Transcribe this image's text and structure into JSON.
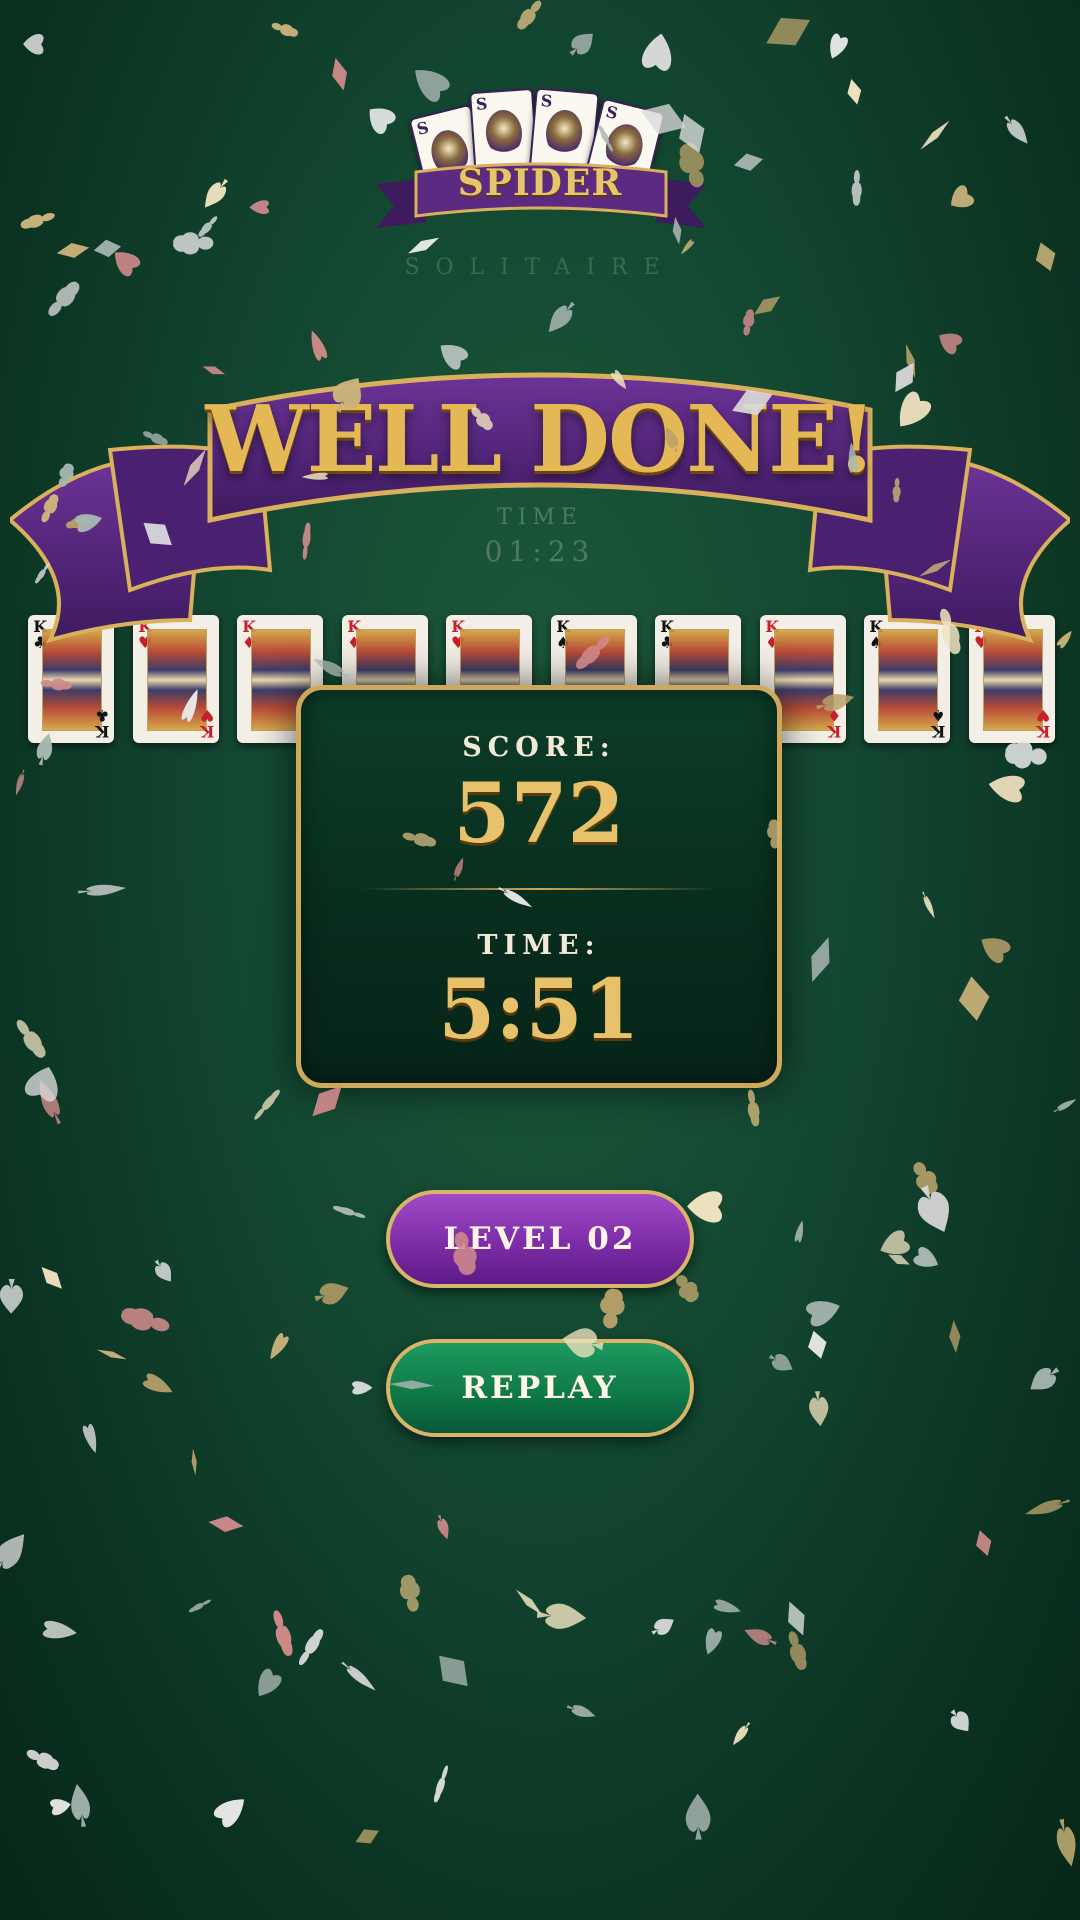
{
  "colors": {
    "felt": "#124530",
    "gold": "#e8c26a",
    "purple": "#5d2a82",
    "level_button": "#7a2aa4",
    "replay_button": "#0f7a48"
  },
  "logo": {
    "card_mark": "S",
    "title": "SPIDER",
    "subtitle": "SOLITAIRE"
  },
  "banner": {
    "title": "WELL DONE!",
    "time_label": "TIME",
    "time_value": "01:23"
  },
  "completed_kings": [
    {
      "suit": "club",
      "symbol": "♣",
      "color": "black"
    },
    {
      "suit": "heart",
      "symbol": "♥",
      "color": "red"
    },
    {
      "suit": "diamond",
      "symbol": "♦",
      "color": "red"
    },
    {
      "suit": "diamond",
      "symbol": "♦",
      "color": "red"
    },
    {
      "suit": "heart",
      "symbol": "♥",
      "color": "red"
    },
    {
      "suit": "spade",
      "symbol": "♠",
      "color": "black"
    },
    {
      "suit": "club",
      "symbol": "♣",
      "color": "black"
    },
    {
      "suit": "diamond",
      "symbol": "♦",
      "color": "red"
    },
    {
      "suit": "spade",
      "symbol": "♠",
      "color": "black"
    },
    {
      "suit": "heart",
      "symbol": "♥",
      "color": "red"
    }
  ],
  "king_rank": "K",
  "results": {
    "score_label": "SCORE:",
    "score_value": "572",
    "time_label": "TIME:",
    "time_value": "5:51"
  },
  "buttons": {
    "level_label": "LEVEL 02",
    "replay_label": "REPLAY"
  },
  "confetti_icons": [
    "spade-icon",
    "club-icon",
    "heart-icon",
    "diamond-icon"
  ]
}
